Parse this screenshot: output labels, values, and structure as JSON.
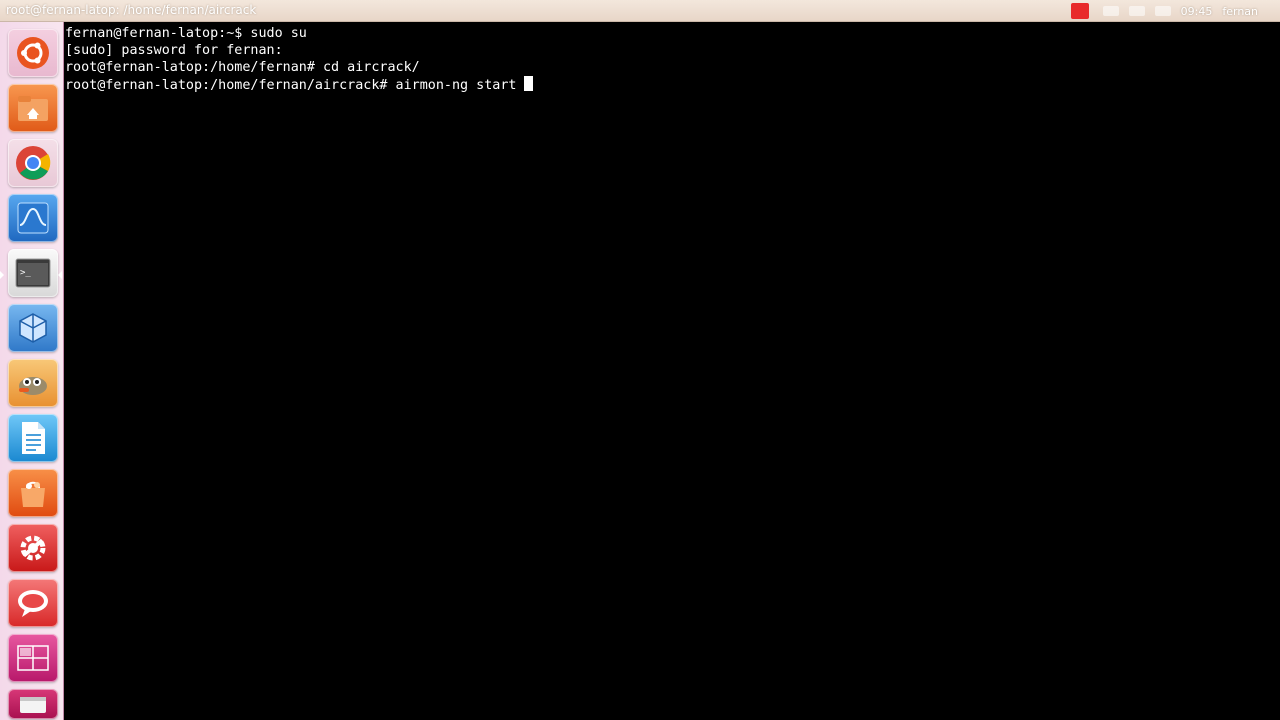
{
  "window": {
    "title": "root@fernan-latop: /home/fernan/aircrack"
  },
  "indicators": {
    "items": [
      "",
      "",
      ""
    ],
    "time": "09:45",
    "user": "fernan"
  },
  "launcher": {
    "items": [
      {
        "icon": "ubuntu-logo-icon",
        "color": "#e95420"
      },
      {
        "icon": "home-folder-icon",
        "color": "#f07a2c"
      },
      {
        "icon": "chrome-icon",
        "color": "#4285f4"
      },
      {
        "icon": "system-monitor-icon",
        "color": "#2f7fd6"
      },
      {
        "icon": "terminal-icon",
        "color": "#dadada"
      },
      {
        "icon": "virtualbox-icon",
        "color": "#2c7fc9"
      },
      {
        "icon": "gimp-icon",
        "color": "#f0a030"
      },
      {
        "icon": "text-document-icon",
        "color": "#2aa0e0"
      },
      {
        "icon": "software-center-icon",
        "color": "#f06020"
      },
      {
        "icon": "settings-icon",
        "color": "#e03030"
      },
      {
        "icon": "chat-icon",
        "color": "#e84040"
      },
      {
        "icon": "workspace-switcher-icon",
        "color": "#d0307a"
      },
      {
        "icon": "trash-icon",
        "color": "#c02060"
      }
    ]
  },
  "terminal": {
    "lines": [
      "fernan@fernan-latop:~$ sudo su",
      "[sudo] password for fernan:",
      "root@fernan-latop:/home/fernan# cd aircrack/",
      "root@fernan-latop:/home/fernan/aircrack# airmon-ng start"
    ]
  }
}
